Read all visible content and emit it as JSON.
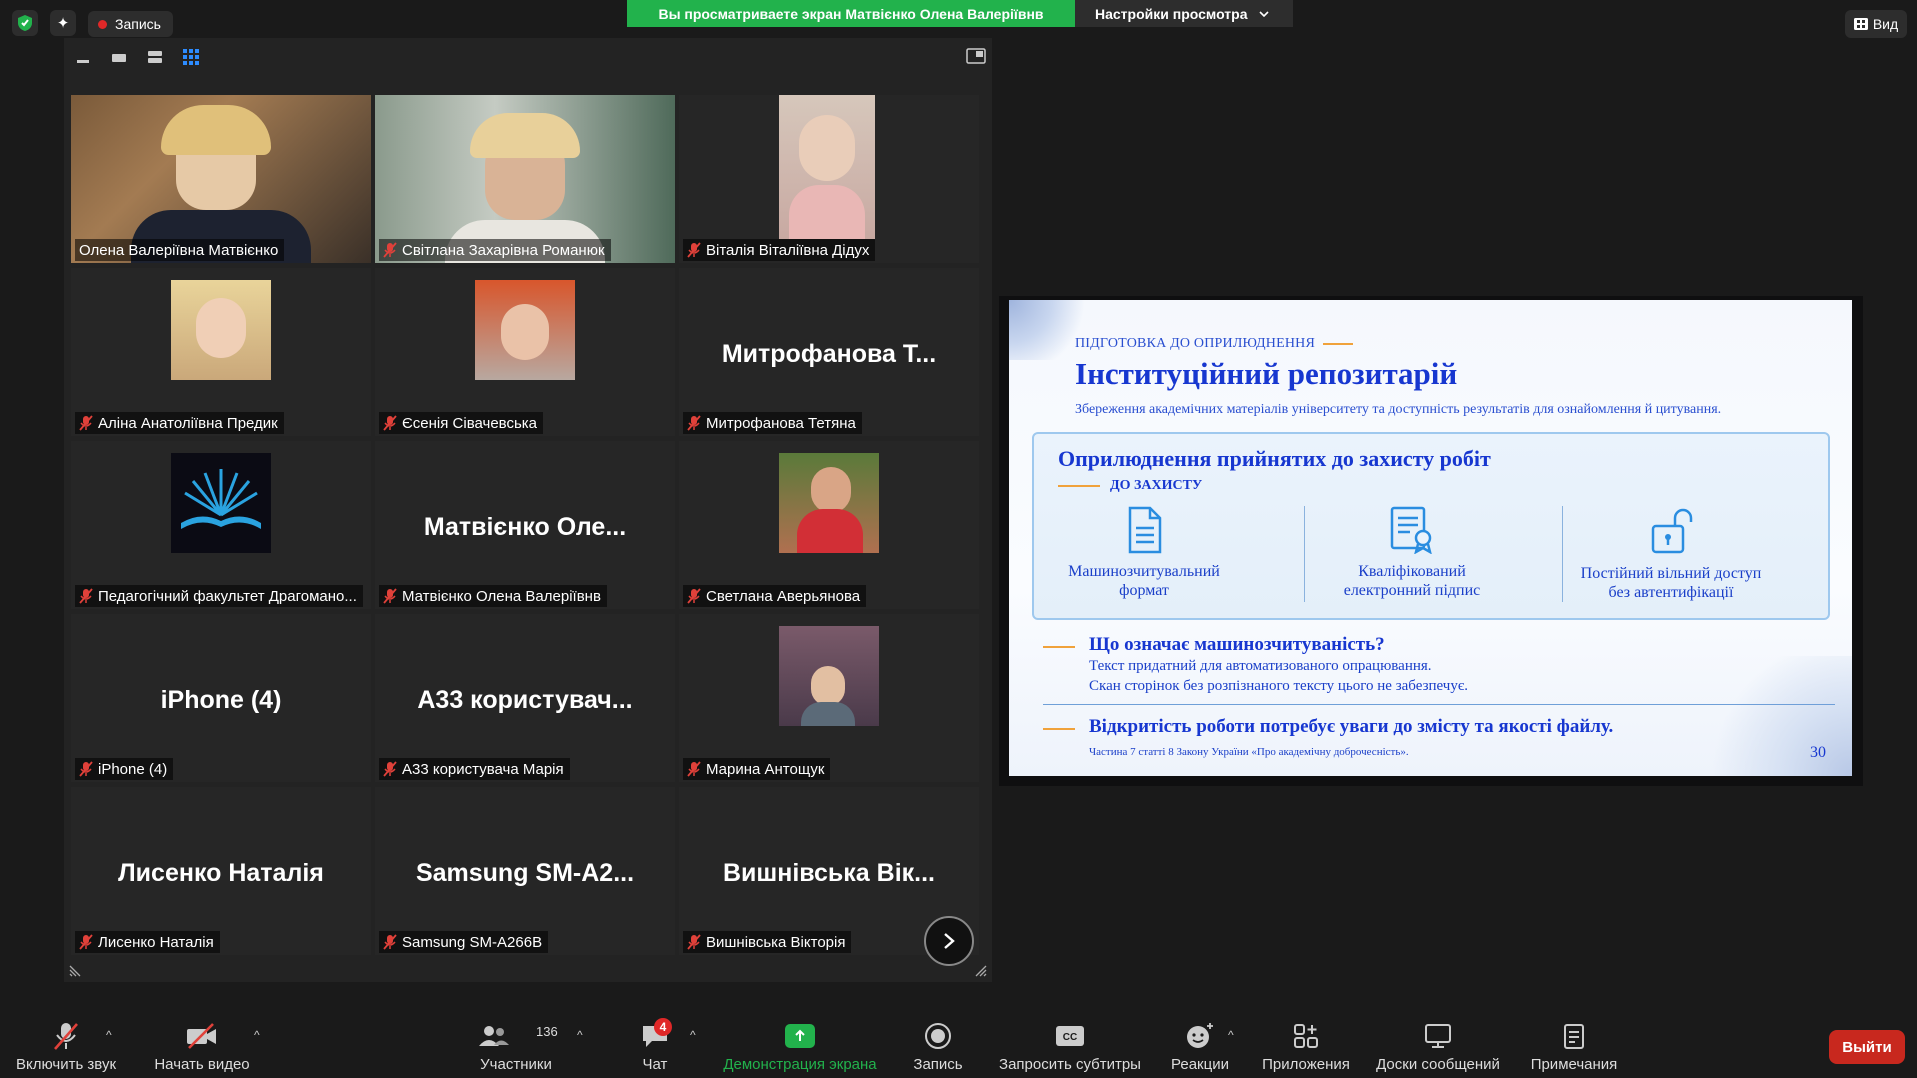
{
  "top": {
    "record_label": "Запись",
    "share_banner": "Вы просматриваете экран Матвієнко Олена Валеріївнв",
    "view_settings_label": "Настройки просмотра",
    "view_label": "Вид"
  },
  "gallery": {
    "tiles": [
      {
        "name": "Олена Валеріївна Матвієнко",
        "big": "",
        "kind": "video",
        "active": true,
        "muted": false
      },
      {
        "name": "Світлана Захарівна Романюк",
        "big": "",
        "kind": "video",
        "muted": true
      },
      {
        "name": "Віталія Віталіївна Дідух",
        "big": "",
        "kind": "photo",
        "muted": true
      },
      {
        "name": "Аліна Анатоліївна Предик",
        "big": "",
        "kind": "photo",
        "muted": true
      },
      {
        "name": "Єсенія Сівачевська",
        "big": "",
        "kind": "photo",
        "muted": true
      },
      {
        "name": "Митрофанова Тетяна",
        "big": "Митрофанова Т...",
        "kind": "text",
        "muted": true
      },
      {
        "name": "Педагогічний факультет Драгомано...",
        "big": "",
        "kind": "logo",
        "muted": true
      },
      {
        "name": "Матвієнко Олена Валеріївнв",
        "big": "Матвієнко Оле...",
        "kind": "text",
        "muted": true
      },
      {
        "name": "Светлана Аверьянова",
        "big": "",
        "kind": "photo",
        "muted": true
      },
      {
        "name": "iPhone (4)",
        "big": "iPhone (4)",
        "kind": "text",
        "muted": true
      },
      {
        "name": "A33 користувача Марія",
        "big": "A33  користувач...",
        "kind": "text",
        "muted": true
      },
      {
        "name": "Марина Антощук",
        "big": "",
        "kind": "photo",
        "muted": true
      },
      {
        "name": "Лисенко Наталія",
        "big": "Лисенко Наталія",
        "kind": "text",
        "muted": true
      },
      {
        "name": "Samsung SM-A266B",
        "big": "Samsung  SM-A2...",
        "kind": "text",
        "muted": true
      },
      {
        "name": "Вишнівська Вікторія",
        "big": "Вишнівська Вік...",
        "kind": "text",
        "muted": true
      }
    ]
  },
  "slide": {
    "kicker": "ПІДГОТОВКА ДО ОПРИЛЮДНЕННЯ",
    "title": "Інституційний репозитарій",
    "subtitle": "Збереження академічних матеріалів університету та доступність результатів для ознайомлення й цитування.",
    "box_title": "Оприлюднення прийнятих до захисту робіт",
    "box_kicker": "ДО ЗАХИСТУ",
    "col1_line1": "Машинозчитувальний",
    "col1_line2": "формат",
    "col2_line1": "Кваліфікований",
    "col2_line2": "електронний підпис",
    "col3_line1": "Постійний вільний доступ",
    "col3_line2": "без автентифікації",
    "question": "Що означає машинозчитуваність?",
    "line1": "Текст придатний для автоматизованого опрацювання.",
    "line2": "Скан сторінок без розпізнаного тексту цього не забезпечує.",
    "openness": "Відкритість роботи потребує уваги до змісту та якості файлу.",
    "footnote": "Частина 7 статті 8 Закону України «Про академічну доброчесність».",
    "page": "30"
  },
  "toolbar": {
    "audio": "Включить звук",
    "video": "Начать видео",
    "participants": "Участники",
    "participants_count": "136",
    "chat": "Чат",
    "chat_badge": "4",
    "share": "Демонстрация экрана",
    "record": "Запись",
    "captions": "Запросить субтитры",
    "reactions": "Реакции",
    "apps": "Приложения",
    "whiteboards": "Доски сообщений",
    "notes": "Примечания",
    "leave": "Выйти"
  },
  "colors": {
    "share_green": "#22b24c",
    "active_border": "#d8e14a",
    "leave_red": "#c8281e",
    "mute_red": "#e0413a",
    "slide_blue": "#1737d0"
  }
}
